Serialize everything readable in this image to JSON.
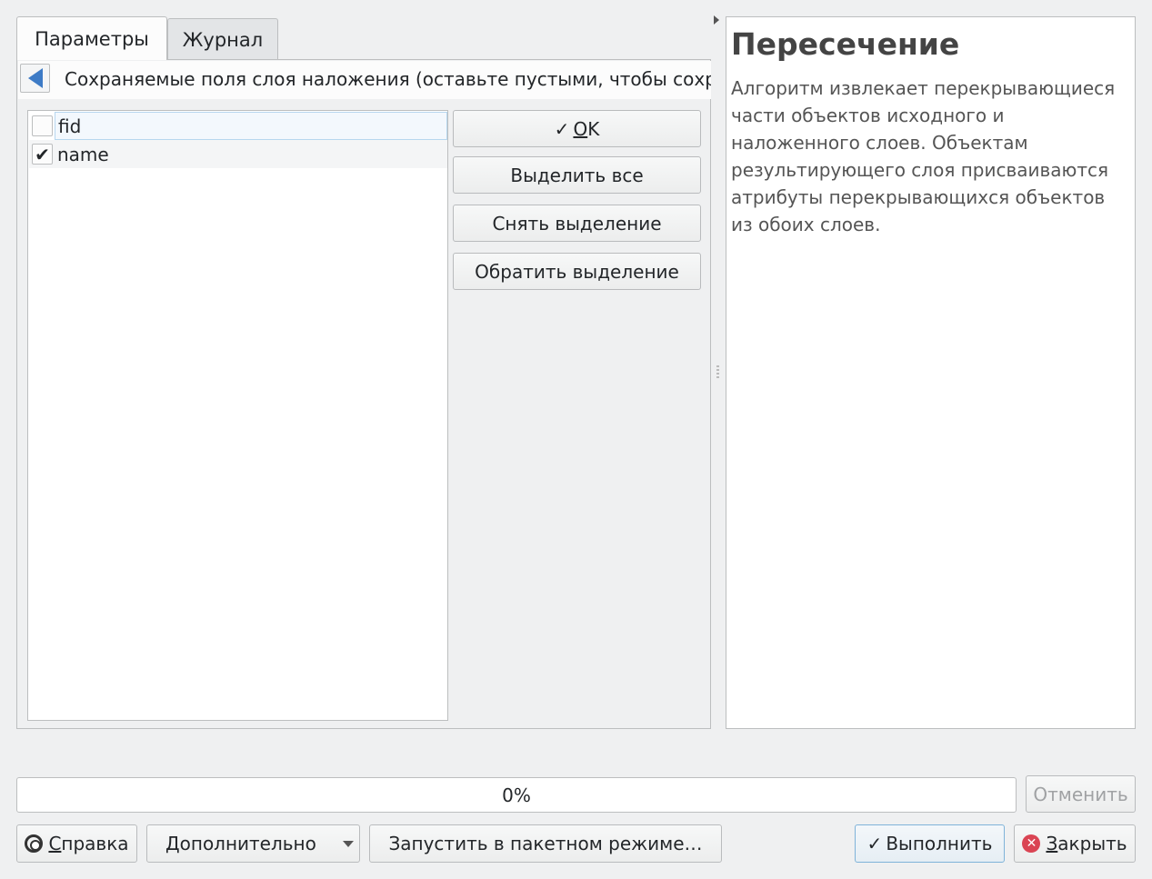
{
  "tabs": [
    {
      "label": "Параметры",
      "active": true
    },
    {
      "label": "Журнал",
      "active": false
    }
  ],
  "panel": {
    "header_text": "Сохраняемые поля слоя наложения (оставьте пустыми, чтобы сохранить все поля)",
    "back_icon": "arrow-left-icon"
  },
  "fields": [
    {
      "label": "fid",
      "checked": false
    },
    {
      "label": "name",
      "checked": true
    }
  ],
  "side_buttons": {
    "ok_label_rest": "K",
    "ok_label_mnemonic": "O",
    "select_all": "Выделить все",
    "deselect": "Снять выделение",
    "invert": "Обратить выделение"
  },
  "help": {
    "title": "Пересечение",
    "text": "Алгоритм извлекает перекрывающиеся части объектов исходного и наложенного слоев. Объектам результирующего слоя присваиваются атрибуты перекрывающихся объектов из обоих слоев."
  },
  "progress": {
    "text": "0%",
    "value": 0
  },
  "bottom": {
    "cancel": "Отменить",
    "help_mnemonic": "С",
    "help_rest": "правка",
    "advanced": "Дополнительно",
    "batch": "Запустить в пакетном режиме…",
    "run": "Выполнить",
    "close_mnemonic": "З",
    "close_rest": "акрыть"
  },
  "colors": {
    "accent": "#3d7bc6",
    "close": "#da4453"
  }
}
